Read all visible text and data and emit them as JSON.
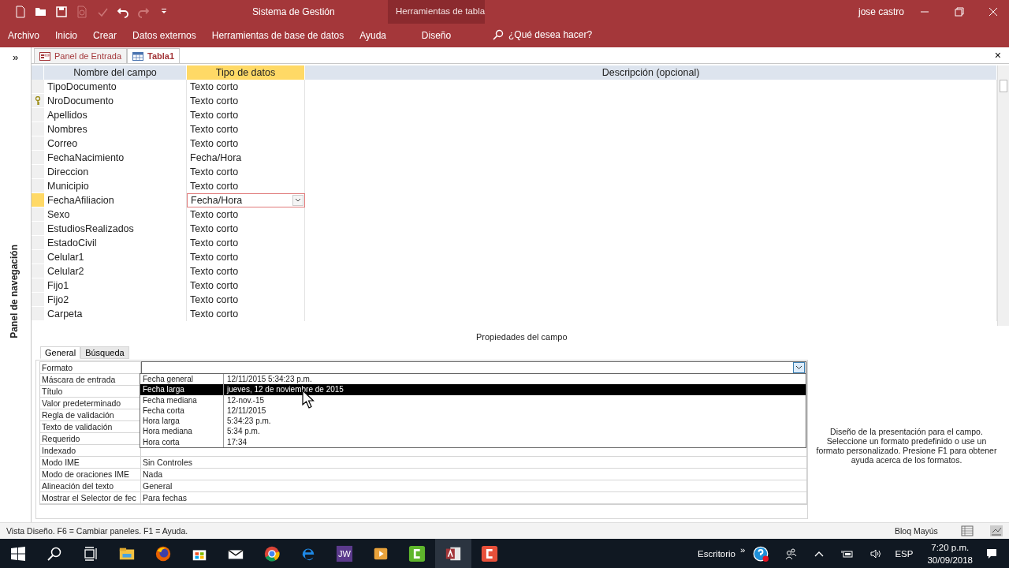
{
  "window": {
    "title": "Sistema de Gestión",
    "context_group": "Herramientas de tabla",
    "user": "jose castro"
  },
  "ribbon_tabs": [
    {
      "label": "Archivo",
      "kind": "normal"
    },
    {
      "label": "Inicio",
      "kind": "normal"
    },
    {
      "label": "Crear",
      "kind": "normal"
    },
    {
      "label": "Datos externos",
      "kind": "normal"
    },
    {
      "label": "Herramientas de base de datos",
      "kind": "normal"
    },
    {
      "label": "Ayuda",
      "kind": "normal"
    },
    {
      "label": "Diseño",
      "kind": "contextual"
    }
  ],
  "tell_me": {
    "placeholder": "¿Qué desea hacer?"
  },
  "nav_pane": {
    "toggle": "»",
    "title": "Panel de navegación"
  },
  "document_tabs": [
    {
      "label": "Panel de Entrada",
      "kind": "form",
      "selected": false
    },
    {
      "label": "Tabla1",
      "kind": "table",
      "selected": true
    }
  ],
  "close_glyph": "×",
  "design_grid": {
    "columns": [
      "Nombre del campo",
      "Tipo de datos",
      "Descripción (opcional)"
    ],
    "rows": [
      {
        "name": "TipoDocumento",
        "type": "Texto corto",
        "primary_key": false,
        "selected": false
      },
      {
        "name": "NroDocumento",
        "type": "Texto corto",
        "primary_key": true,
        "selected": false
      },
      {
        "name": "Apellidos",
        "type": "Texto corto",
        "primary_key": false,
        "selected": false
      },
      {
        "name": "Nombres",
        "type": "Texto corto",
        "primary_key": false,
        "selected": false
      },
      {
        "name": "Correo",
        "type": "Texto corto",
        "primary_key": false,
        "selected": false
      },
      {
        "name": "FechaNacimiento",
        "type": "Fecha/Hora",
        "primary_key": false,
        "selected": false
      },
      {
        "name": "Direccion",
        "type": "Texto corto",
        "primary_key": false,
        "selected": false
      },
      {
        "name": "Municipio",
        "type": "Texto corto",
        "primary_key": false,
        "selected": false
      },
      {
        "name": "FechaAfiliacion",
        "type": "Fecha/Hora",
        "primary_key": false,
        "selected": true
      },
      {
        "name": "Sexo",
        "type": "Texto corto",
        "primary_key": false,
        "selected": false
      },
      {
        "name": "EstudiosRealizados",
        "type": "Texto corto",
        "primary_key": false,
        "selected": false
      },
      {
        "name": "EstadoCivil",
        "type": "Texto corto",
        "primary_key": false,
        "selected": false
      },
      {
        "name": "Celular1",
        "type": "Texto corto",
        "primary_key": false,
        "selected": false
      },
      {
        "name": "Celular2",
        "type": "Texto corto",
        "primary_key": false,
        "selected": false
      },
      {
        "name": "Fijo1",
        "type": "Texto corto",
        "primary_key": false,
        "selected": false
      },
      {
        "name": "Fijo2",
        "type": "Texto corto",
        "primary_key": false,
        "selected": false
      },
      {
        "name": "Carpeta",
        "type": "Texto corto",
        "primary_key": false,
        "selected": false
      }
    ]
  },
  "field_properties": {
    "title": "Propiedades del campo",
    "tabs": [
      {
        "label": "General",
        "selected": true
      },
      {
        "label": "Búsqueda",
        "selected": false
      }
    ],
    "rows": [
      {
        "label": "Formato"
      },
      {
        "label": "Máscara de entrada"
      },
      {
        "label": "Título"
      },
      {
        "label": "Valor predeterminado"
      },
      {
        "label": "Regla de validación"
      },
      {
        "label": "Texto de validación"
      },
      {
        "label": "Requerido"
      },
      {
        "label": "Indexado"
      },
      {
        "label": "Modo IME",
        "value": "Sin Controles"
      },
      {
        "label": "Modo de oraciones IME",
        "value": "Nada"
      },
      {
        "label": "Alineación del texto",
        "value": "General"
      },
      {
        "label": "Mostrar el Selector de fec",
        "value": "Para fechas"
      }
    ],
    "format_options": [
      {
        "name": "Fecha general",
        "example": "12/11/2015 5:34:23 p.m.",
        "selected": false
      },
      {
        "name": "Fecha larga",
        "example": "jueves, 12 de noviembre de 2015",
        "selected": true
      },
      {
        "name": "Fecha mediana",
        "example": "12-nov.-15",
        "selected": false
      },
      {
        "name": "Fecha corta",
        "example": "12/11/2015",
        "selected": false
      },
      {
        "name": "Hora larga",
        "example": "5:34:23 p.m.",
        "selected": false
      },
      {
        "name": "Hora mediana",
        "example": "5:34 p.m.",
        "selected": false
      },
      {
        "name": "Hora corta",
        "example": "17:34",
        "selected": false
      }
    ],
    "help": "Diseño de la presentación para el campo. Seleccione un formato predefinido o use un formato personalizado. Presione F1 para obtener ayuda acerca de los formatos."
  },
  "status_bar": {
    "text": "Vista Diseño.  F6 = Cambiar paneles.  F1 = Ayuda.",
    "caps_lock": "Bloq Mayús"
  },
  "taskbar": {
    "apps": [
      {
        "kind": "explorer",
        "selected": false
      },
      {
        "kind": "firefox",
        "selected": false
      },
      {
        "kind": "store",
        "selected": false
      },
      {
        "kind": "mail",
        "selected": false
      },
      {
        "kind": "chrome",
        "selected": false
      },
      {
        "kind": "edge",
        "selected": false
      },
      {
        "kind": "jw",
        "label": "JW",
        "selected": false
      },
      {
        "kind": "player",
        "selected": false
      },
      {
        "kind": "camtasia",
        "selected": false
      },
      {
        "kind": "access",
        "selected": true
      },
      {
        "kind": "recorder",
        "selected": false
      }
    ],
    "desktop": "Escritorio",
    "more": "»",
    "language": "ESP",
    "time": "7:20 p.m.",
    "date": "30/09/2018"
  }
}
